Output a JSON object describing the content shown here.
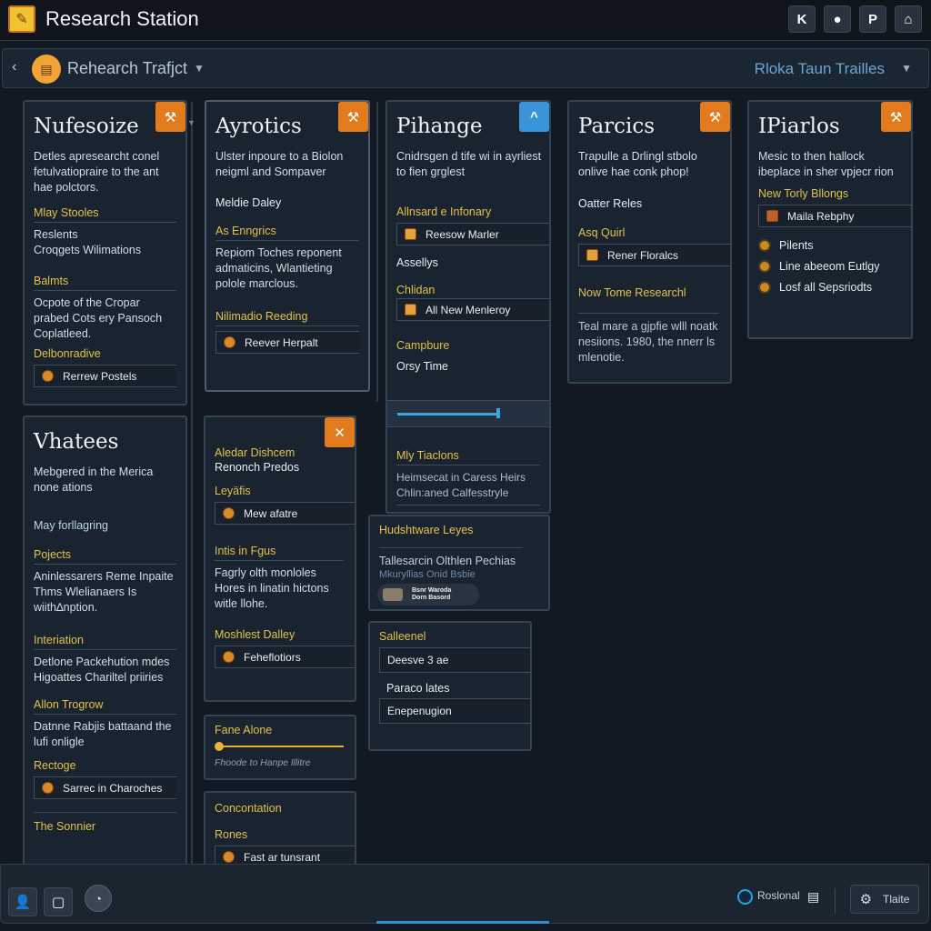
{
  "app": {
    "title": "Research Station",
    "toolbar_icons": [
      "k-icon",
      "microphone-icon",
      "p-icon",
      "user-desk-icon"
    ]
  },
  "project_bar": {
    "title": "Rehearch Trafjct",
    "right_label": "Rloka Taun Trailles"
  },
  "cards": {
    "c1": {
      "title": "Nufesoize",
      "desc": "Detles apresearcht conel fetulvatiopraire to the ant hae polctors.",
      "h1": "Mlay Stooles",
      "t1a": "Reslents",
      "t1b": "Croqgets Wilimations",
      "h2": "Balmts",
      "t2": "Ocpote of the Cropar prabed Cots ery Pansoch Coplatleed.",
      "h3": "Delbonradive",
      "field": "Rerrew Postels"
    },
    "c2": {
      "title": "Ayrotics",
      "desc": "Ulster inpoure to a Biolon neigml and Sompaver",
      "sub": "Meldie Daley",
      "h1": "As Enngrics",
      "t1": "Repiom Toches reponent admaticins, Wlantieting polole marclous.",
      "h2": "Nilimadio Reeding",
      "field": "Reever Herpalt"
    },
    "c3": {
      "title": "Pihange",
      "desc": "Cnidrsgen d tife wi in ayrliest to fien grglest",
      "h1": "Allnsard e Infonary",
      "field1": "Reesow Marler",
      "sub1": "Assellys",
      "h2": "Chlidan",
      "field2": "All New Menleroy",
      "h3": "Campbure",
      "sub2": "Orsy Time",
      "slider_value": 0.85,
      "h4": "Mly Tiaclons",
      "t4": "Heimsecat in Caress Heirs Chlin:aned Calfesstryle"
    },
    "c4": {
      "title": "Parcics",
      "desc": "Trapulle a Drlingl stbolo onlive hae conk phop!",
      "sub": "Oatter Reles",
      "h1": "Asq Quirl",
      "field": "Rener Floralcs",
      "h2": "Now Tome Researchl",
      "t2": "Teal mare a gjpfie wlll noatk nesiions. 1980, the nnerr ls mlenotie."
    },
    "c5": {
      "title": "IPiarlos",
      "desc": "Mesic to then hallock ibeplace in sher vpjecr rion",
      "h1": "New Torly Bllongs",
      "field": "Maila Rebphy",
      "bullets": [
        "Pilents",
        "Line abeeom Eutlgy",
        "Losf all Sepsriodts"
      ]
    },
    "c6": {
      "title": "Vhatees",
      "desc": "Mebgered in the Merica none ations",
      "link": "May forllagring",
      "h1": "Pojects",
      "t1": "Aninlessarers Reme Inpaite Thms Wlelianaers Is wiith∆nption.",
      "h2": "Interiation",
      "t2": "Detlone Packehution mdes Higoattes Chariltel priiries",
      "h3": "Allon Trogrow",
      "t3": "Datnne Rabjis battaand the lufi onligle",
      "h4": "Rectoge",
      "field": "Sarrec in Charoches",
      "h5": "The Sonnier"
    },
    "c7": {
      "h1": "Aledar Dishcem",
      "sub": "Renonch Predos",
      "h2": "Leyäfis",
      "field1": "Mew afatre",
      "h3": "Intis in Fgus",
      "t3": "Fagrly olth monloles Hores in linatin hictons witle llohe.",
      "h4": "Moshlest Dalley",
      "field2": "Feheflotiors"
    },
    "c8": {
      "h1": "Fane Alone",
      "slider_value": 1.0,
      "caption": "Fhoode to Hanpe lllitre"
    },
    "c9": {
      "h1": "Concontation",
      "h2": "Rones",
      "field": "Fast ar tunsrant"
    },
    "c10": {
      "h1": "Hudshtware Leyes",
      "t1": "Tallesarcin Olthlen Pechias",
      "t2": "Mkuryllias Onid Bsbie",
      "chip_line1": "Bsnr Waroda",
      "chip_line2": "Dorn Basord"
    },
    "c11": {
      "h1": "Salleenel",
      "field1": "Deesve 3 ae",
      "sub": "Paraco lates",
      "field2": "Enepenugion"
    }
  },
  "bottom_bar": {
    "status_label": "Roslonal",
    "theme_label": "Tlaite",
    "progress": 0.19
  }
}
